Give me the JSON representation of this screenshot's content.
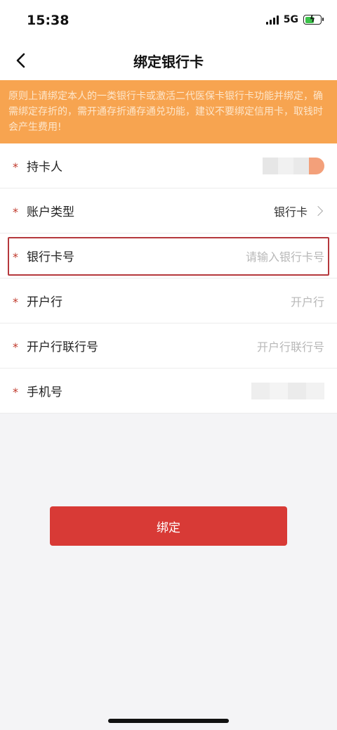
{
  "status": {
    "time": "15:38",
    "network": "5G"
  },
  "nav": {
    "title": "绑定银行卡"
  },
  "notice": {
    "text": "原则上请绑定本人的一类银行卡或激活二代医保卡银行卡功能并绑定，确需绑定存折的，需开通存折通存通兑功能，建议不要绑定信用卡，取钱时会产生费用!"
  },
  "form": {
    "rows": [
      {
        "label": "持卡人",
        "required": "*"
      },
      {
        "label": "账户类型",
        "required": "*",
        "value": "银行卡"
      },
      {
        "label": "银行卡号",
        "required": "*",
        "placeholder": "请输入银行卡号"
      },
      {
        "label": "开户行",
        "required": "*",
        "placeholder": "开户行"
      },
      {
        "label": "开户行联行号",
        "required": "*",
        "placeholder": "开户行联行号"
      },
      {
        "label": "手机号",
        "required": "*"
      }
    ]
  },
  "actions": {
    "bind_label": "绑定"
  },
  "colors": {
    "notice_bg": "#f7a450",
    "primary": "#d83a36",
    "required": "#c0392b"
  }
}
